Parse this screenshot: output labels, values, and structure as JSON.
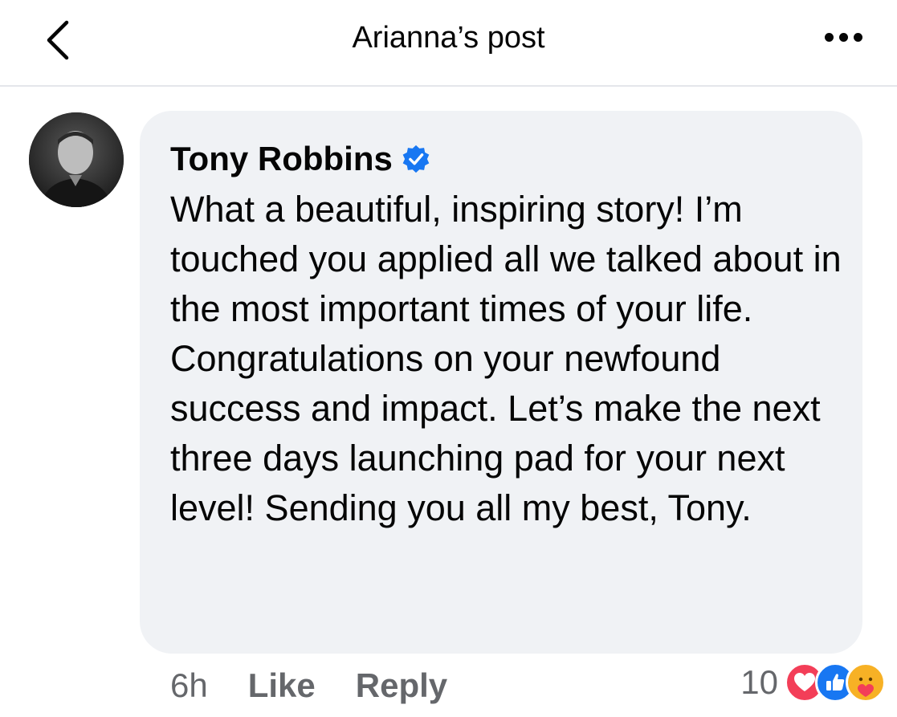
{
  "header": {
    "title": "Arianna’s post",
    "back_icon": "chevron-left-icon",
    "more_icon": "more-horizontal-icon"
  },
  "comment": {
    "author": "Tony Robbins",
    "verified_icon": "verified-badge-icon",
    "text": "What a beautiful, inspiring story! I’m touched you applied all we talked about in the most important times of your life. Congratulations on your newfound success and impact. Let’s make the next three days launching pad for your next level! Sending you all my best, Tony.",
    "time": "6h",
    "like_label": "Like",
    "reply_label": "Reply",
    "reaction_count": "10",
    "reactions": [
      "love-reaction-icon",
      "like-reaction-icon",
      "care-reaction-icon"
    ]
  },
  "colors": {
    "bubble_bg": "#f0f2f5",
    "secondary_text": "#65676b",
    "verified_blue": "#1877f2",
    "love_red": "#f33e58",
    "care_yellow": "#f7b125"
  }
}
